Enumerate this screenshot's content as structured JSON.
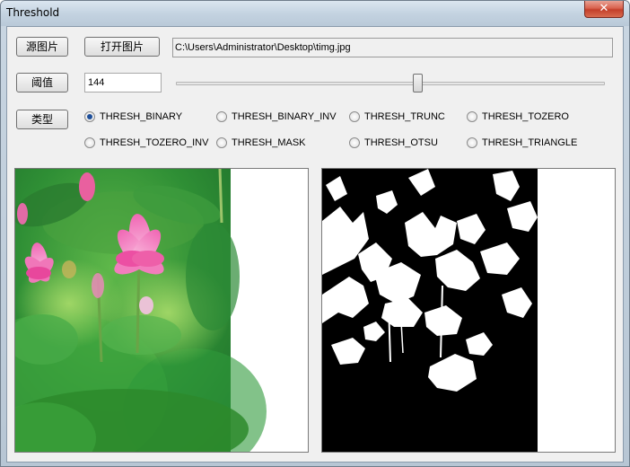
{
  "window": {
    "title": "Threshold",
    "close_label": "✕"
  },
  "toolbar": {
    "source_image_label": "源图片",
    "open_image_label": "打开图片",
    "file_path": "C:\\Users\\Administrator\\Desktop\\timg.jpg",
    "threshold_label": "阈值",
    "threshold_value": "144",
    "type_label": "类型"
  },
  "slider": {
    "value": 144,
    "min": 0,
    "max": 255
  },
  "threshold_types": [
    {
      "label": "THRESH_BINARY",
      "checked": true
    },
    {
      "label": "THRESH_BINARY_INV",
      "checked": false
    },
    {
      "label": "THRESH_TRUNC",
      "checked": false
    },
    {
      "label": "THRESH_TOZERO",
      "checked": false
    },
    {
      "label": "THRESH_TOZERO_INV",
      "checked": false
    },
    {
      "label": "THRESH_MASK",
      "checked": false
    },
    {
      "label": "THRESH_OTSU",
      "checked": false
    },
    {
      "label": "THRESH_TRIANGLE",
      "checked": false
    }
  ],
  "colors": {
    "close_button": "#d9624e",
    "radio_selected": "#1e4f9a",
    "client_bg": "#f0f0f0"
  }
}
